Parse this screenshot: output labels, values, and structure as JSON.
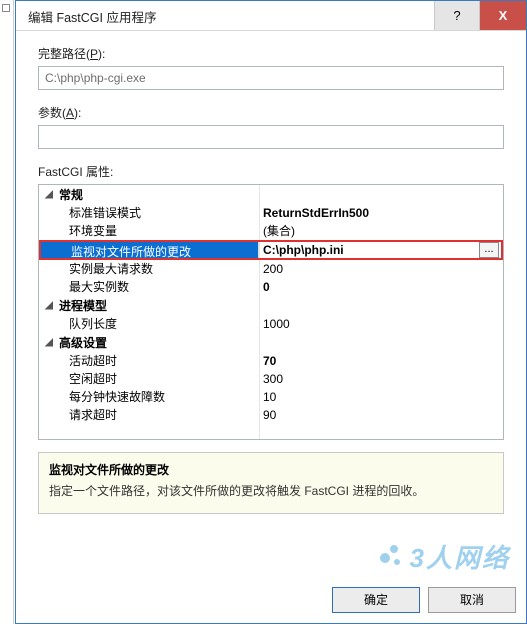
{
  "titlebar": {
    "title": "编辑 FastCGI 应用程序",
    "help": "?",
    "close": "X"
  },
  "fields": {
    "full_path_label_pre": "完整路径(",
    "full_path_accel": "P",
    "full_path_label_post": "):",
    "full_path_value": "C:\\php\\php-cgi.exe",
    "args_label_pre": "参数(",
    "args_accel": "A",
    "args_label_post": "):",
    "args_value": ""
  },
  "grid": {
    "label": "FastCGI 属性:",
    "groups": [
      {
        "title": "常规",
        "expanded": true,
        "rows": [
          {
            "name": "标准错误模式",
            "value": "ReturnStdErrIn500",
            "bold": true
          },
          {
            "name": "环境变量",
            "value": "(集合)",
            "bold": false
          },
          {
            "name": "监视对文件所做的更改",
            "value": "C:\\php\\php.ini",
            "highlighted": true
          },
          {
            "name": "实例最大请求数",
            "value": "200",
            "bold": false
          },
          {
            "name": "最大实例数",
            "value": "0",
            "bold": true
          }
        ]
      },
      {
        "title": "进程模型",
        "expanded": true,
        "rows": [
          {
            "name": "队列长度",
            "value": "1000",
            "bold": false
          }
        ]
      },
      {
        "title": "高级设置",
        "expanded": true,
        "rows": [
          {
            "name": "活动超时",
            "value": "70",
            "bold": true
          },
          {
            "name": "空闲超时",
            "value": "300",
            "bold": false
          },
          {
            "name": "每分钟快速故障数",
            "value": "10",
            "bold": false
          },
          {
            "name": "请求超时",
            "value": "90",
            "bold": false
          }
        ]
      }
    ],
    "ellipsis": "..."
  },
  "description": {
    "title": "监视对文件所做的更改",
    "text": "指定一个文件路径，对该文件所做的更改将触发 FastCGI 进程的回收。"
  },
  "watermark": "3人网络",
  "buttons": {
    "ok": "确定",
    "cancel": "取消"
  }
}
